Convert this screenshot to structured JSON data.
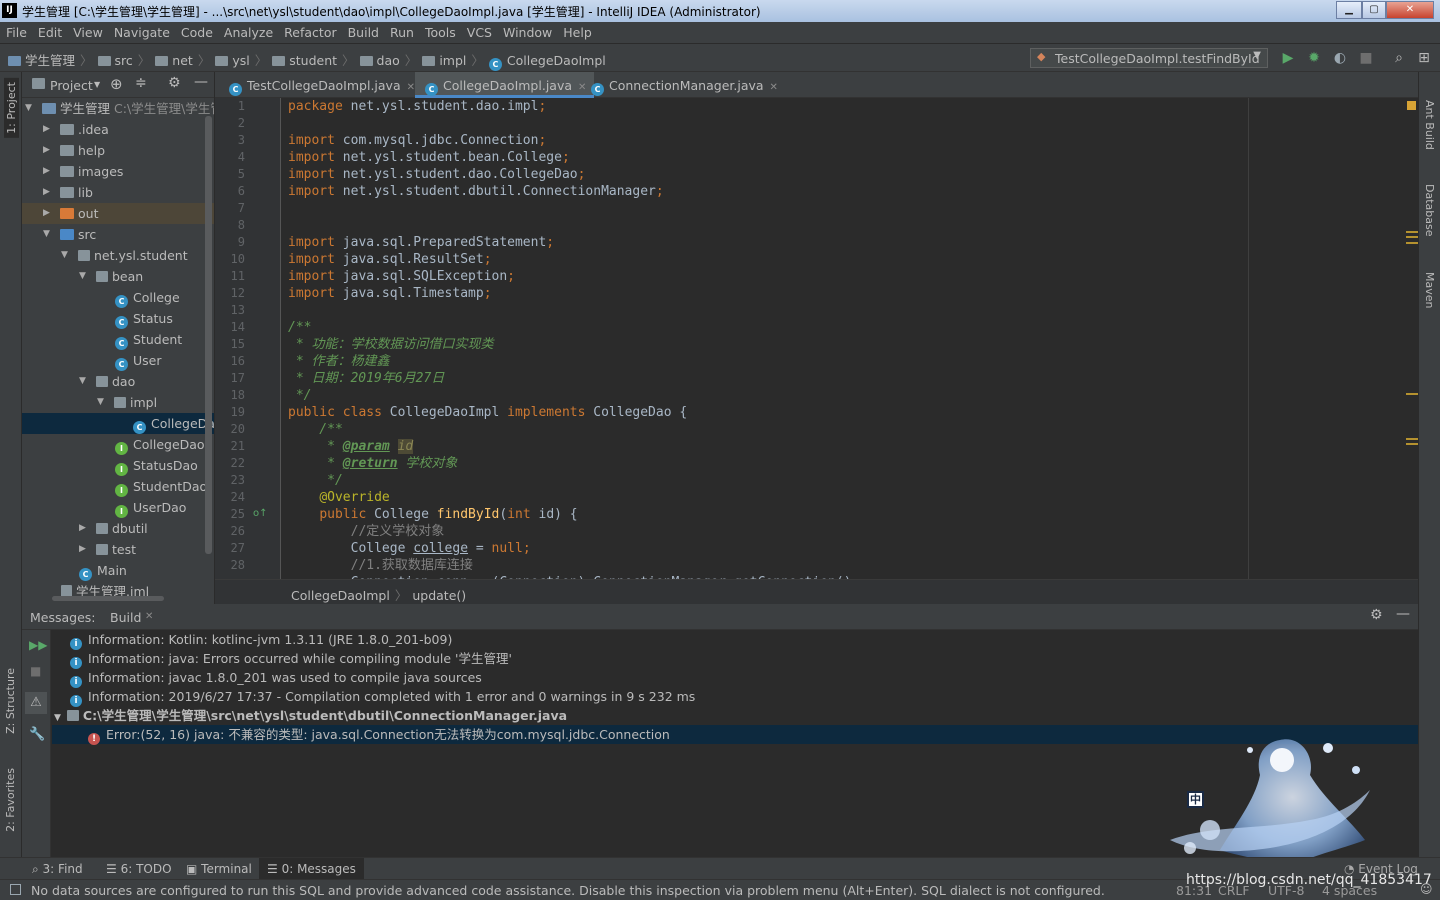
{
  "window": {
    "title": "学生管理 [C:\\学生管理\\学生管理] - ...\\src\\net\\ysl\\student\\dao\\impl\\CollegeDaoImpl.java [学生管理] - IntelliJ IDEA (Administrator)"
  },
  "menu": [
    "File",
    "Edit",
    "View",
    "Navigate",
    "Code",
    "Analyze",
    "Refactor",
    "Build",
    "Run",
    "Tools",
    "VCS",
    "Window",
    "Help"
  ],
  "breadcrumb": [
    "学生管理",
    "src",
    "net",
    "ysl",
    "student",
    "dao",
    "impl",
    "CollegeDaoImpl"
  ],
  "run_config": "TestCollegeDaoImpl.testFindById",
  "left_tools": {
    "project": "1: Project",
    "structure": "Z: Structure",
    "favorites": "2: Favorites"
  },
  "right_tools": {
    "ant": "Ant Build",
    "database": "Database",
    "maven": "Maven"
  },
  "project_panel": {
    "title": "Project",
    "tree": [
      {
        "label": "学生管理",
        "suffix": "C:\\学生管理\\学生管",
        "type": "module"
      },
      {
        "label": ".idea",
        "type": "folder"
      },
      {
        "label": "help",
        "type": "folder"
      },
      {
        "label": "images",
        "type": "folder"
      },
      {
        "label": "lib",
        "type": "folder"
      },
      {
        "label": "out",
        "type": "folder-orange"
      },
      {
        "label": "src",
        "type": "folder-blue"
      },
      {
        "label": "net.ysl.student",
        "type": "package"
      },
      {
        "label": "bean",
        "type": "package"
      },
      {
        "label": "College",
        "type": "class"
      },
      {
        "label": "Status",
        "type": "class"
      },
      {
        "label": "Student",
        "type": "class"
      },
      {
        "label": "User",
        "type": "class"
      },
      {
        "label": "dao",
        "type": "package"
      },
      {
        "label": "impl",
        "type": "package"
      },
      {
        "label": "CollegeDaoImpl",
        "type": "class"
      },
      {
        "label": "CollegeDao",
        "type": "interface"
      },
      {
        "label": "StatusDao",
        "type": "interface"
      },
      {
        "label": "StudentDao",
        "type": "interface"
      },
      {
        "label": "UserDao",
        "type": "interface"
      },
      {
        "label": "dbutil",
        "type": "package"
      },
      {
        "label": "test",
        "type": "package"
      },
      {
        "label": "Main",
        "type": "main"
      },
      {
        "label": "学生管理.iml",
        "type": "file"
      }
    ]
  },
  "tabs": [
    {
      "label": "TestCollegeDaoImpl.java"
    },
    {
      "label": "CollegeDaoImpl.java"
    },
    {
      "label": "ConnectionManager.java"
    }
  ],
  "editor_breadcrumb": {
    "cls": "CollegeDaoImpl",
    "method": "update()"
  },
  "messages": {
    "header": "Messages:",
    "tab": "Build",
    "items": [
      {
        "kind": "info",
        "text": "Information: Kotlin: kotlinc-jvm 1.3.11 (JRE 1.8.0_201-b09)"
      },
      {
        "kind": "info",
        "text": "Information: java: Errors occurred while compiling module '学生管理'"
      },
      {
        "kind": "info",
        "text": "Information: javac 1.8.0_201 was used to compile java sources"
      },
      {
        "kind": "info",
        "text": "Information: 2019/6/27 17:37 - Compilation completed with 1 error and 0 warnings in 9 s 232 ms"
      },
      {
        "kind": "file",
        "text": "C:\\学生管理\\学生管理\\src\\net\\ysl\\student\\dbutil\\ConnectionManager.java"
      },
      {
        "kind": "error",
        "text": "Error:(52, 16)  java: 不兼容的类型: java.sql.Connection无法转换为com.mysql.jdbc.Connection"
      }
    ]
  },
  "bottom_tools": [
    "3: Find",
    "6: TODO",
    "Terminal",
    "0: Messages",
    "Event Log"
  ],
  "status": {
    "text": "No data sources are configured to run this SQL and provide advanced code assistance. Disable this inspection via problem menu (Alt+Enter). SQL dialect is not configured.",
    "position": "81:31",
    "line_sep": "CRLF",
    "encoding": "UTF-8",
    "indent": "4 spaces",
    "watermark": "https://blog.csdn.net/qq_41853417"
  },
  "colors": {
    "bg": "#2b2b2b",
    "panel": "#3c3f41",
    "keyword": "#cc7832",
    "comment": "#808080",
    "doc": "#629755",
    "selection": "#0d293e"
  }
}
